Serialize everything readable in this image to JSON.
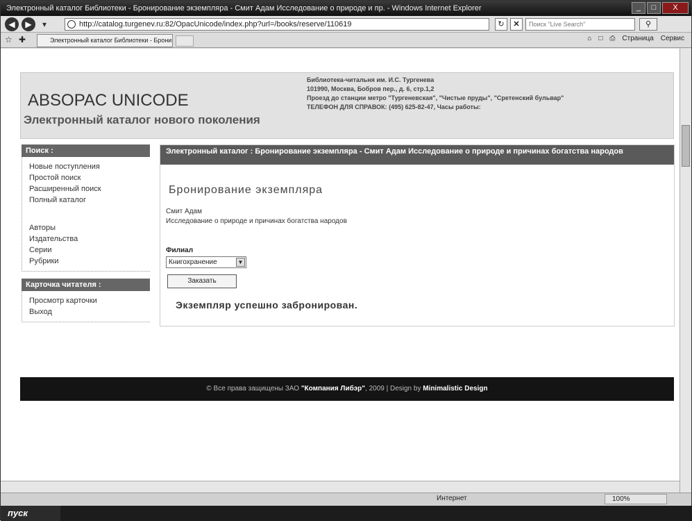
{
  "window": {
    "title": "Электронный каталог Библиотеки - Бронирование экземпляра - Смит Адам Исследование о природе и пр. - Windows Internet Explorer",
    "minimize": "_",
    "maximize": "□",
    "close": "X"
  },
  "address_bar": {
    "url": "http://catalog.turgenev.ru:82/OpacUnicode/index.php?url=/books/reserve/110619",
    "search_placeholder": "Поиск \"Live Search\""
  },
  "tabs": {
    "active_tab": "Электронный каталог Библиотеки - Бронирование...",
    "page_menu": "Страница",
    "tools_menu": "Сервис"
  },
  "header": {
    "logo": "ABSOPAC UNICODE",
    "tagline": "Электронный каталог нового поколения",
    "library_name": "Библиотека-читальня им. И.С. Тургенева",
    "address": "101990, Москва, Бобров пер., д. 6, стр.1,2",
    "directions": "Проезд до станции метро \"Тургеневская\", \"Чистые пруды\", \"Сретенский бульвар\"",
    "phone": "ТЕЛЕФОН ДЛЯ СПРАВОК: (495) 625-82-47, Часы работы:"
  },
  "sidebar": {
    "search_header": "Поиск :",
    "search_items": [
      "Новые поступления",
      "Простой поиск",
      "Расширенный поиск",
      "Полный каталог"
    ],
    "index_items": [
      "Авторы",
      "Издательства",
      "Серии",
      "Рубрики"
    ],
    "reader_header": "Карточка читателя :",
    "reader_items": [
      "Просмотр карточки",
      "Выход"
    ]
  },
  "content": {
    "breadcrumb": "Электронный каталог : Бронирование экземпляра - Смит Адам Исследование о природе и причинах богатства народов",
    "page_title": "Бронирование экземпляра",
    "author": "Смит Адам",
    "book_title": "Исследование о природе и причинах богатства народов",
    "branch_label": "Филиал",
    "branch_value": "Книгохранение",
    "order_button": "Заказать",
    "success_message": "Экземпляр успешно забронирован."
  },
  "footer": {
    "prefix": "© Все права защищены ЗАО ",
    "company": "\"Компания Либэр\"",
    "middle": ", 2009 | Design by ",
    "designer": "Minimalistic Design"
  },
  "status_bar": {
    "zone": "Интернет",
    "zoom": "100%"
  },
  "taskbar": {
    "start": "пуск"
  }
}
